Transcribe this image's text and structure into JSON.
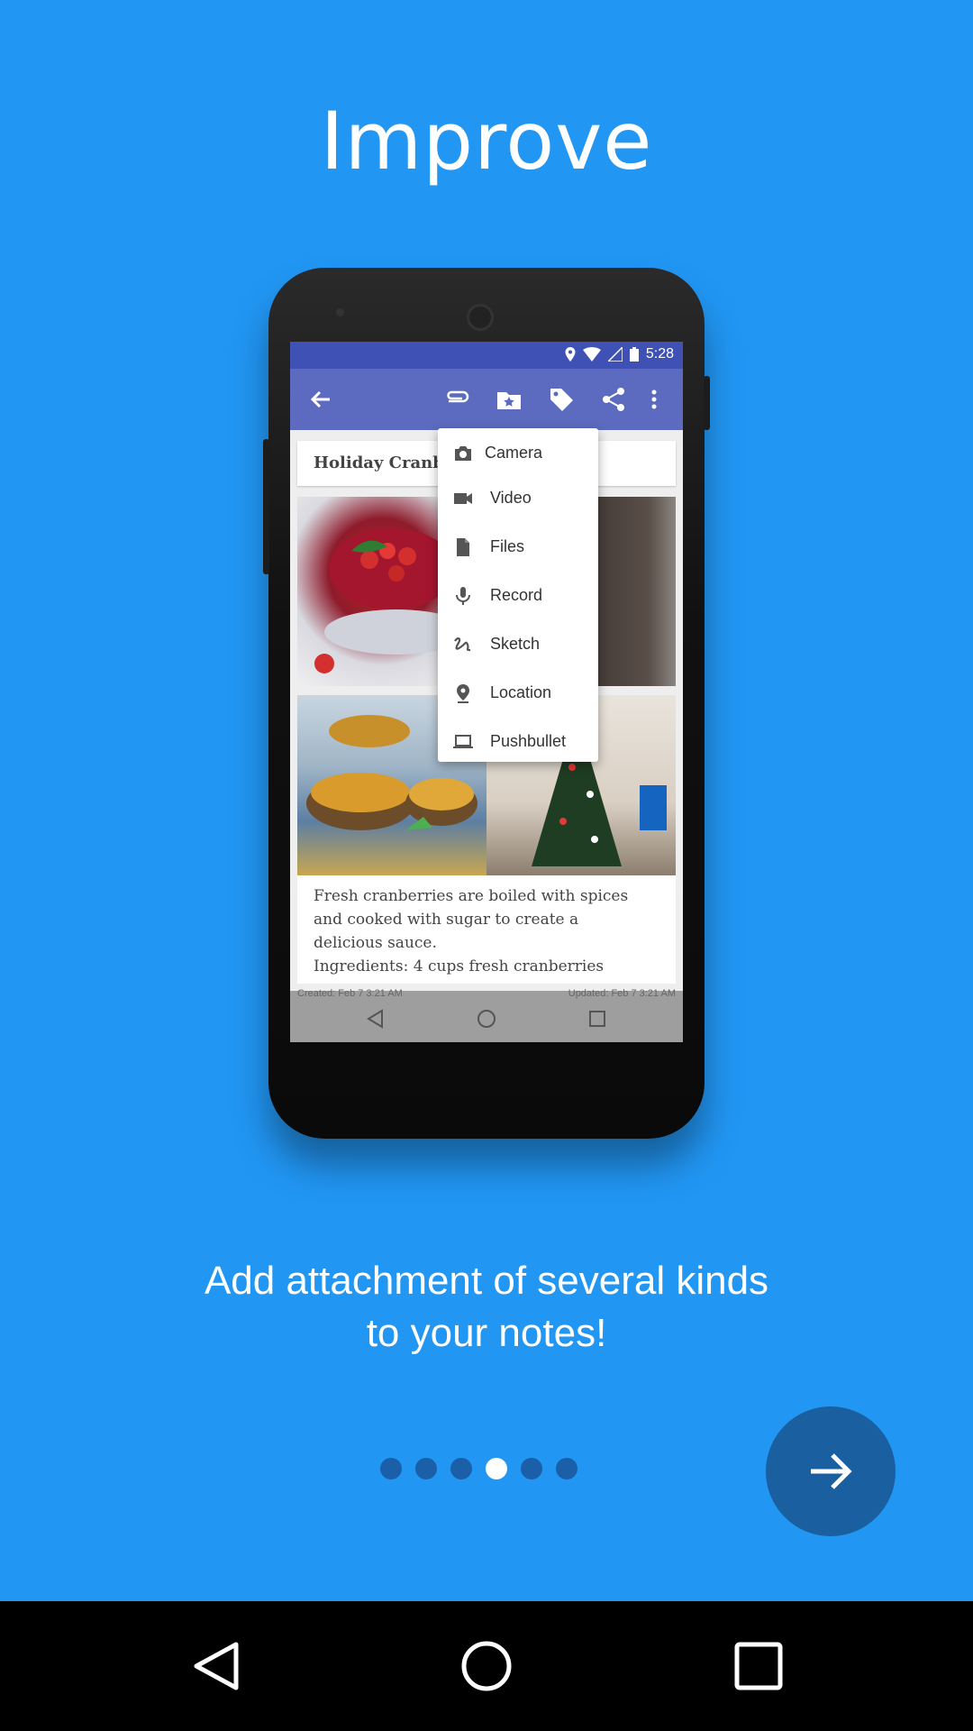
{
  "heading": "Improve",
  "subtitle_line1": "Add attachment of several kinds",
  "subtitle_line2": "to your notes!",
  "pager": {
    "count": 6,
    "active_index": 3
  },
  "colors": {
    "background": "#2196f3",
    "fab": "#1a5fa0",
    "toolbar": "#5c6bc0",
    "statusbar": "#3f51b5"
  },
  "phone": {
    "status_time": "5:28",
    "note_title": "Holiday Cranbe",
    "note_text": [
      "Fresh cranberries are boiled with spices",
      "and cooked with sugar to create a",
      "delicious sauce.",
      "Ingredients: 4 cups fresh cranberries"
    ],
    "created": "Created: Feb 7 3:21 AM",
    "updated": "Updated: Feb 7 3:21 AM",
    "toolbar_icons": [
      "back-arrow-icon",
      "paperclip-icon",
      "folder-star-icon",
      "tag-icon",
      "share-icon",
      "overflow-menu-icon"
    ],
    "attach_menu": [
      {
        "label": "Camera",
        "icon": "camera-icon"
      },
      {
        "label": "Video",
        "icon": "video-icon"
      },
      {
        "label": "Files",
        "icon": "file-icon"
      },
      {
        "label": "Record",
        "icon": "microphone-icon"
      },
      {
        "label": "Sketch",
        "icon": "sketch-icon"
      },
      {
        "label": "Location",
        "icon": "location-pin-icon"
      },
      {
        "label": "Pushbullet",
        "icon": "laptop-icon"
      }
    ]
  },
  "fab_icon": "arrow-right-icon",
  "system_nav": [
    "back-icon",
    "home-icon",
    "recents-icon"
  ]
}
